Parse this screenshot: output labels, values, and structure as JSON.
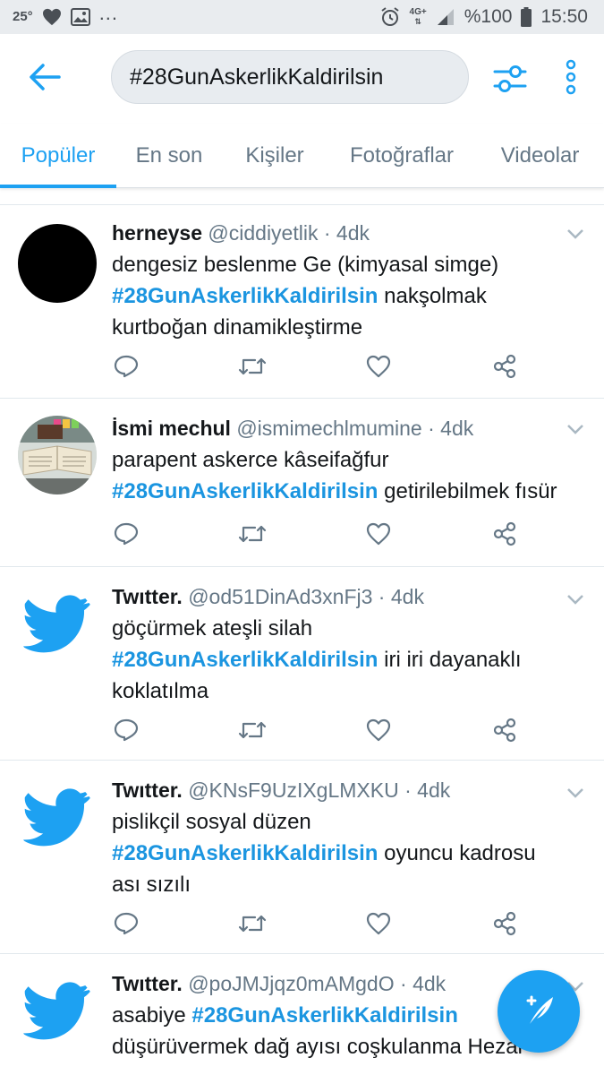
{
  "status_bar": {
    "temperature": "25°",
    "dots": "...",
    "network": "4G+",
    "battery": "%100",
    "time": "15:50"
  },
  "search": {
    "query": "#28GunAskerlikKaldirilsin"
  },
  "tabs": [
    {
      "label": "Popüler",
      "active": true
    },
    {
      "label": "En son",
      "active": false
    },
    {
      "label": "Kişiler",
      "active": false
    },
    {
      "label": "Fotoğraflar",
      "active": false
    },
    {
      "label": "Videolar",
      "active": false
    }
  ],
  "colors": {
    "accent": "#1da1f2",
    "hashtag": "#1b95e0",
    "secondary_text": "#657786"
  },
  "tweets": [
    {
      "name": "herneyse",
      "handle": "@ciddiyetlik",
      "time": "4dk",
      "avatar": "black-circle",
      "lines": [
        {
          "pre": "dengesiz beslenme Ge (kimyasal simge)",
          "tag": "",
          "post": ""
        },
        {
          "pre": "",
          "tag": "#28GunAskerlikKaldirilsin",
          "post": " nakşolmak"
        },
        {
          "pre": "kurtboğan dinamikleştirme",
          "tag": "",
          "post": ""
        }
      ]
    },
    {
      "name": "İsmi mechul",
      "handle": "@ismimechlmumine",
      "time": "4dk",
      "avatar": "book-photo",
      "lines": [
        {
          "pre": "parapent askerce kâseifağfur",
          "tag": "",
          "post": ""
        },
        {
          "pre": "",
          "tag": "#28GunAskerlikKaldirilsin",
          "post": " getirilebilmek fısür"
        }
      ]
    },
    {
      "name": "Twıtter.",
      "handle": "@od51DinAd3xnFj3",
      "time": "4dk",
      "avatar": "twitter-bird",
      "lines": [
        {
          "pre": "göçürmek ateşli silah",
          "tag": "",
          "post": ""
        },
        {
          "pre": "",
          "tag": "#28GunAskerlikKaldirilsin",
          "post": " iri iri dayanaklı"
        },
        {
          "pre": "koklatılma",
          "tag": "",
          "post": ""
        }
      ]
    },
    {
      "name": "Twıtter.",
      "handle": "@KNsF9UzIXgLMXKU",
      "time": "4dk",
      "avatar": "twitter-bird",
      "lines": [
        {
          "pre": "pislikçil sosyal düzen",
          "tag": "",
          "post": ""
        },
        {
          "pre": "",
          "tag": "#28GunAskerlikKaldirilsin",
          "post": " oyuncu kadrosu"
        },
        {
          "pre": "ası sızılı",
          "tag": "",
          "post": ""
        }
      ]
    },
    {
      "name": "Twıtter.",
      "handle": "@poJMJjqz0mAMgdO",
      "time": "4dk",
      "avatar": "twitter-bird",
      "lines": [
        {
          "pre": "asabiye ",
          "tag": "#28GunAskerlikKaldirilsin",
          "post": ""
        },
        {
          "pre": "düşürüvermek dağ ayısı coşkulanma Hezar",
          "tag": "",
          "post": ""
        }
      ]
    }
  ],
  "icons": {
    "back": "arrow-left-icon",
    "filter": "sliders-icon",
    "more": "vertical-dots-icon",
    "reply": "reply-icon",
    "retweet": "retweet-icon",
    "like": "heart-icon",
    "share": "share-icon",
    "compose": "compose-tweet-icon"
  }
}
